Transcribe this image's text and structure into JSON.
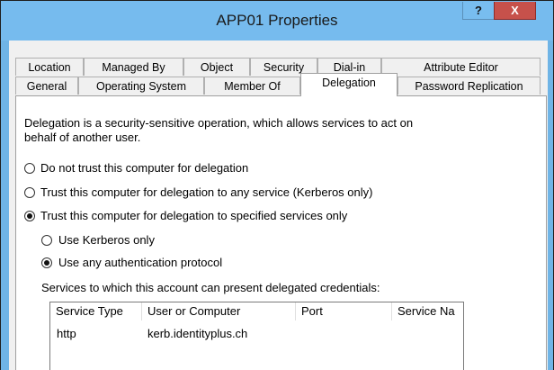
{
  "window": {
    "title": "APP01 Properties",
    "help_label": "?",
    "close_label": "X"
  },
  "tabs": {
    "row1": [
      "Location",
      "Managed By",
      "Object",
      "Security",
      "Dial-in",
      "Attribute Editor"
    ],
    "row2": [
      "General",
      "Operating System",
      "Member Of",
      "Delegation",
      "Password Replication"
    ],
    "active": "Delegation"
  },
  "delegation": {
    "description_line1": "Delegation is a security-sensitive operation, which allows services to act on",
    "description_line2": "behalf of another user.",
    "options": [
      {
        "label": "Do not trust this computer for delegation",
        "selected": false
      },
      {
        "label": "Trust this computer for delegation to any service (Kerberos only)",
        "selected": false
      },
      {
        "label": "Trust this computer for delegation to specified services only",
        "selected": true
      }
    ],
    "sub_options": [
      {
        "label": "Use Kerberos only",
        "selected": false
      },
      {
        "label": "Use any authentication protocol",
        "selected": true
      }
    ],
    "services_label": "Services to which this account can present delegated credentials:",
    "columns": [
      "Service Type",
      "User or Computer",
      "Port",
      "Service Na"
    ],
    "rows": [
      {
        "service_type": "http",
        "user_or_computer": "kerb.identityplus.ch",
        "port": "",
        "service_name": ""
      }
    ]
  }
}
